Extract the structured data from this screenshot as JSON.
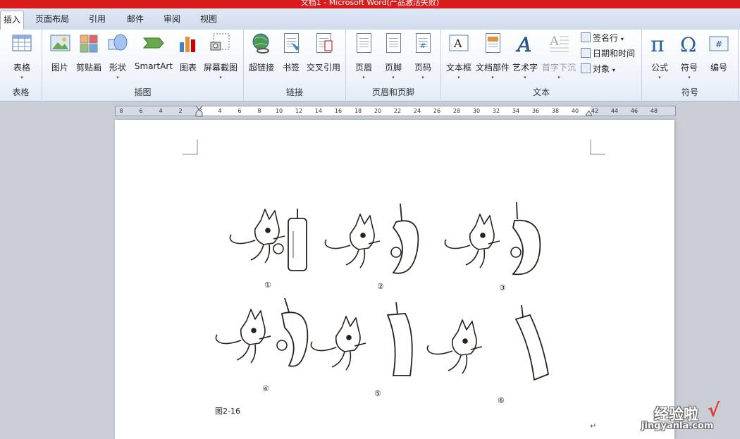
{
  "window": {
    "title": "文档1 - Microsoft Word(产品激活失败)"
  },
  "tabs": [
    "插入",
    "页面布局",
    "引用",
    "邮件",
    "审阅",
    "视图"
  ],
  "ribbon": {
    "groups": {
      "table": "表格",
      "illustrations": "插图",
      "links": "链接",
      "header_footer": "页眉和页脚",
      "text": "文本",
      "symbols": "符号"
    },
    "buttons": {
      "table": "表格",
      "picture": "图片",
      "clipart": "剪贴画",
      "shapes": "形状",
      "smartart": "SmartArt",
      "chart": "图表",
      "screenshot": "屏幕截图",
      "hyperlink": "超链接",
      "bookmark": "书签",
      "crossref": "交叉引用",
      "header": "页眉",
      "footer": "页脚",
      "pagenum": "页码",
      "textbox": "文本框",
      "quickparts": "文档部件",
      "wordart": "艺术字",
      "dropcap": "首字下沉",
      "equation": "公式",
      "symbol": "符号",
      "number": "编号"
    },
    "small_buttons": {
      "signature": "签名行",
      "datetime": "日期和时间",
      "object": "对象"
    },
    "dropdown_glyph": "▾"
  },
  "ruler": {
    "ticks": [
      "8",
      "6",
      "4",
      "2",
      "2",
      "4",
      "6",
      "8",
      "10",
      "12",
      "14",
      "16",
      "18",
      "20",
      "22",
      "24",
      "26",
      "28",
      "30",
      "32",
      "34",
      "36",
      "38",
      "40",
      "42",
      "44",
      "46",
      "48"
    ]
  },
  "document": {
    "figure_numbers": [
      "①",
      "②",
      "③",
      "④",
      "⑤",
      "⑥"
    ],
    "caption": "图2-16",
    "paragraph_mark": "↵"
  },
  "watermark": {
    "line1": "经验啦",
    "check": "√",
    "line2": "jingyanla.com"
  },
  "colors": {
    "title_bar": "#d81c1c",
    "ribbon_bg": "#eef3fa",
    "page_bg": "#ffffff",
    "workspace": "#c9ced6"
  }
}
